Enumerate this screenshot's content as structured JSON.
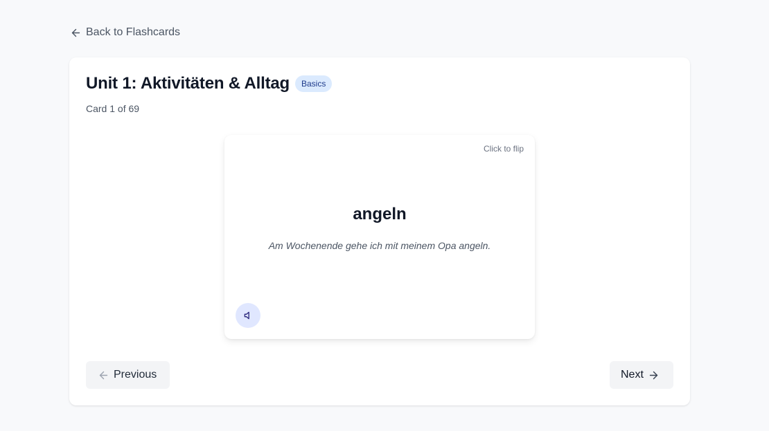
{
  "back_link": {
    "label": "Back to Flashcards",
    "icon": "arrow-left-icon"
  },
  "header": {
    "title": "Unit 1: Aktivitäten & Alltag",
    "badge": "Basics",
    "card_count": "Card 1 of 69"
  },
  "flashcard": {
    "flip_hint": "Click to flip",
    "word": "angeln",
    "example": "Am Wochenende gehe ich mit meinem Opa angeln.",
    "audio_icon": "speaker-icon"
  },
  "navigation": {
    "previous_label": "Previous",
    "next_label": "Next"
  },
  "colors": {
    "background": "#f8f9fb",
    "badge_bg": "#dbeafe",
    "badge_text": "#1e3a8a",
    "audio_bg": "#e0e7ff",
    "button_bg": "#f3f4f6"
  }
}
